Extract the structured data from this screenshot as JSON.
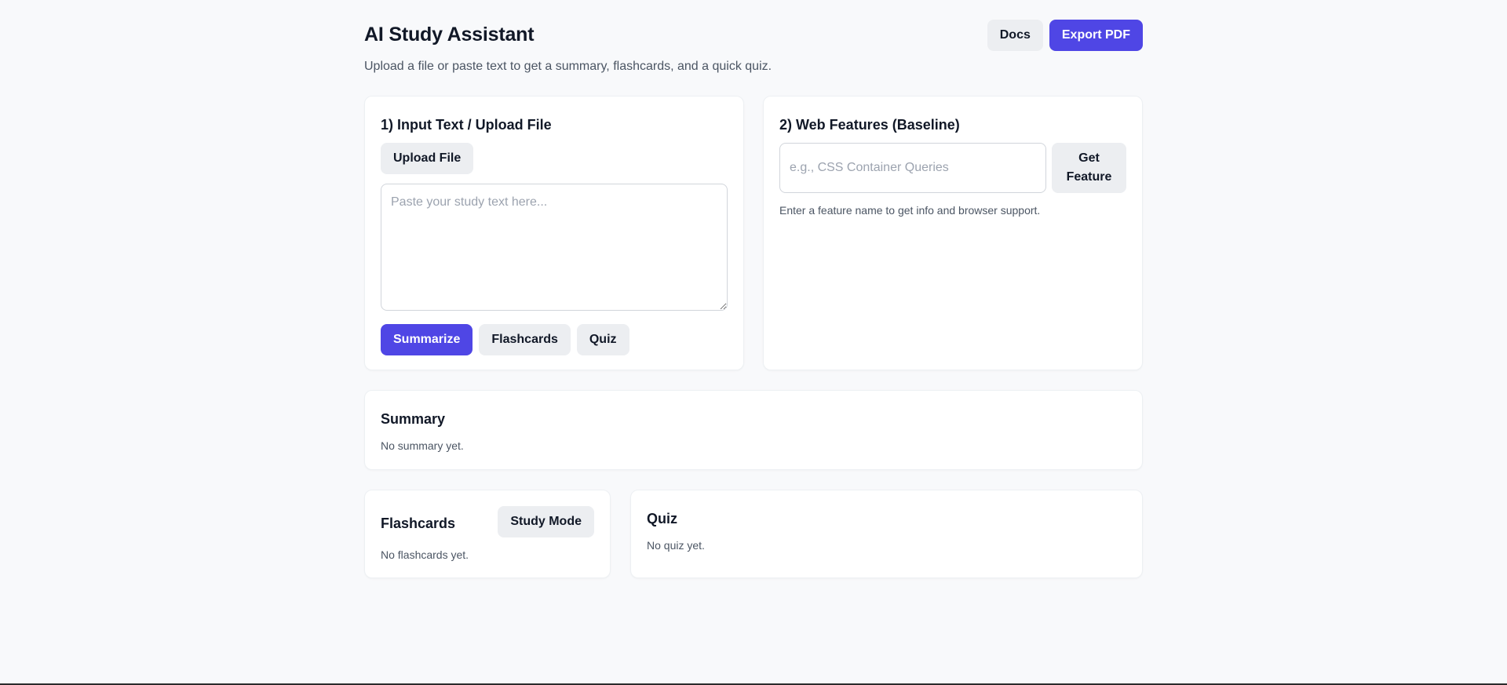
{
  "header": {
    "title": "AI Study Assistant",
    "subtitle": "Upload a file or paste text to get a summary, flashcards, and a quick quiz.",
    "docs_label": "Docs",
    "export_label": "Export PDF"
  },
  "input_card": {
    "title": "1) Input Text / Upload File",
    "upload_label": "Upload File",
    "textarea_value": "",
    "textarea_placeholder": "Paste your study text here...",
    "summarize_label": "Summarize",
    "flashcards_label": "Flashcards",
    "quiz_label": "Quiz"
  },
  "web_card": {
    "title": "2) Web Features (Baseline)",
    "input_value": "",
    "input_placeholder": "e.g., CSS Container Queries",
    "get_feature_label": "Get Feature",
    "hint": "Enter a feature name to get info and browser support."
  },
  "summary_card": {
    "title": "Summary",
    "empty_text": "No summary yet."
  },
  "flashcards_card": {
    "title": "Flashcards",
    "study_mode_label": "Study Mode",
    "empty_text": "No flashcards yet."
  },
  "quiz_card": {
    "title": "Quiz",
    "empty_text": "No quiz yet."
  },
  "colors": {
    "accent": "#4f46e5",
    "background": "#f8f9fb",
    "secondary_button": "#eceef1"
  }
}
